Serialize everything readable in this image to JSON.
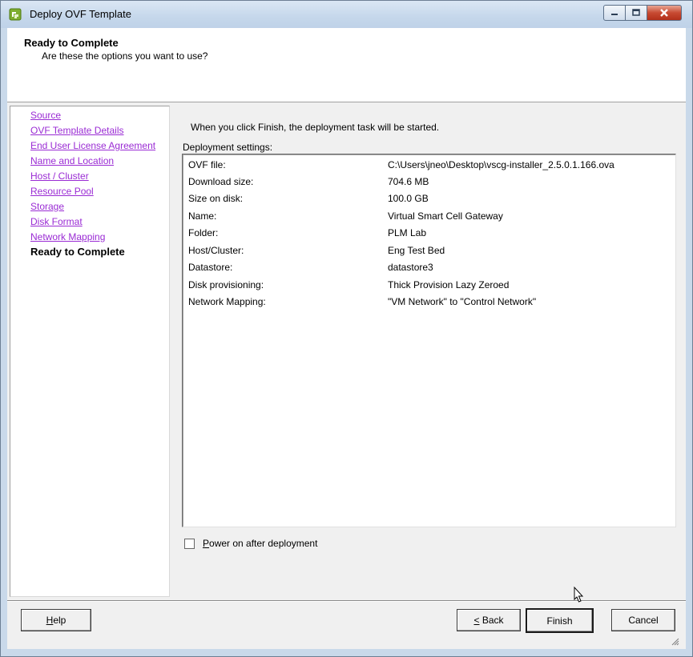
{
  "window": {
    "title": "Deploy OVF Template"
  },
  "header": {
    "title": "Ready to Complete",
    "subtitle": "Are these the options you want to use?"
  },
  "steps": [
    {
      "label": "Source",
      "state": "link"
    },
    {
      "label": "OVF Template Details",
      "state": "link"
    },
    {
      "label": "End User License Agreement",
      "state": "link"
    },
    {
      "label": "Name and Location",
      "state": "link"
    },
    {
      "label": "Host / Cluster",
      "state": "link"
    },
    {
      "label": "Resource Pool",
      "state": "link"
    },
    {
      "label": "Storage",
      "state": "link"
    },
    {
      "label": "Disk Format",
      "state": "link"
    },
    {
      "label": "Network Mapping",
      "state": "link"
    },
    {
      "label": "Ready to Complete",
      "state": "current"
    }
  ],
  "main": {
    "intro": "When you click Finish, the deployment task will be started.",
    "settings_label": "Deployment settings:",
    "settings": [
      {
        "key": "OVF file:",
        "value": "C:\\Users\\jneo\\Desktop\\vscg-installer_2.5.0.1.166.ova"
      },
      {
        "key": "Download size:",
        "value": "704.6 MB"
      },
      {
        "key": "Size on disk:",
        "value": "100.0 GB"
      },
      {
        "key": "Name:",
        "value": "Virtual Smart Cell Gateway"
      },
      {
        "key": "Folder:",
        "value": "PLM Lab"
      },
      {
        "key": "Host/Cluster:",
        "value": "Eng Test Bed"
      },
      {
        "key": "Datastore:",
        "value": "datastore3"
      },
      {
        "key": "Disk provisioning:",
        "value": "Thick Provision Lazy Zeroed"
      },
      {
        "key": "Network Mapping:",
        "value": "\"VM Network\" to \"Control Network\""
      }
    ],
    "power_on_label": "Power on after deployment",
    "power_on_checked": false
  },
  "buttons": {
    "help": "Help",
    "back": "Back",
    "finish": "Finish",
    "cancel": "Cancel"
  },
  "colors": {
    "link": "#9a2bd4",
    "titlebar": "#c9d9ea",
    "close_button": "#c74a32"
  }
}
